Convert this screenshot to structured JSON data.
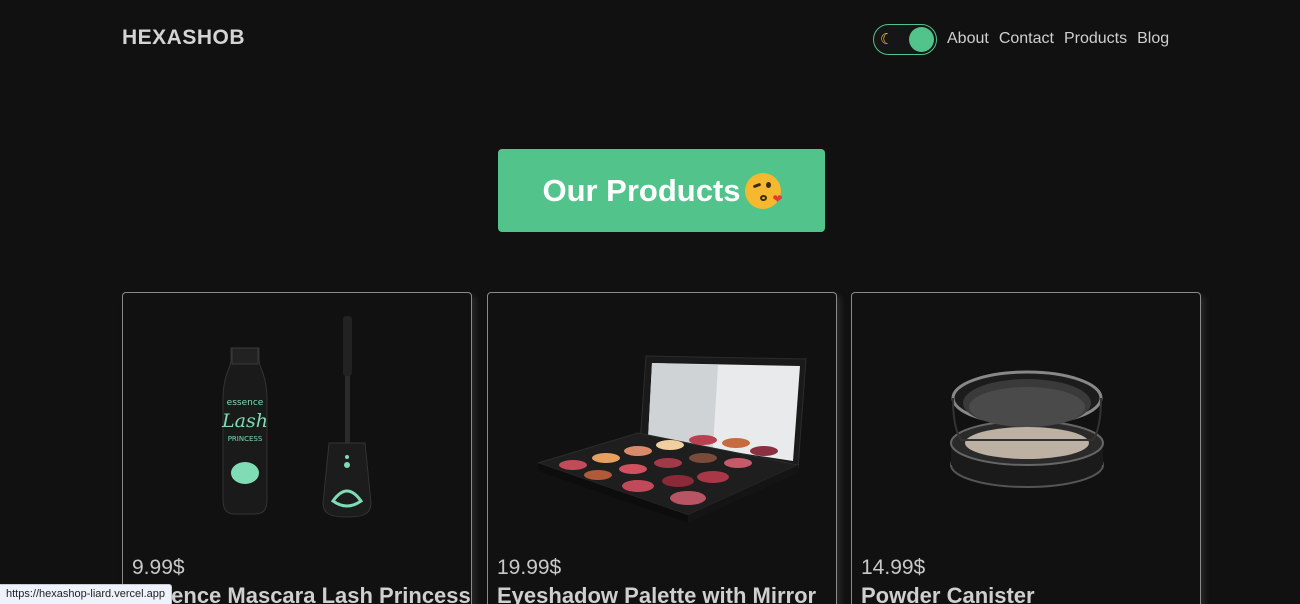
{
  "header": {
    "brand": "HEXASHOB",
    "theme_toggle_icon": "moon-icon",
    "nav": [
      "About",
      "Contact",
      "Products",
      "Blog"
    ]
  },
  "hero": {
    "title": "Our Products",
    "emoji": "face-blowing-kiss-icon"
  },
  "products": [
    {
      "price": "9.99$",
      "name": "Essence Mascara Lash Princess",
      "image": "mascara-image"
    },
    {
      "price": "19.99$",
      "name": "Eyeshadow Palette with Mirror",
      "image": "eyeshadow-palette-image"
    },
    {
      "price": "14.99$",
      "name": "Powder Canister",
      "image": "powder-canister-image"
    }
  ],
  "status_url": "https://hexashop-liard.vercel.app",
  "colors": {
    "accent": "#52c38b",
    "background": "#111111"
  }
}
